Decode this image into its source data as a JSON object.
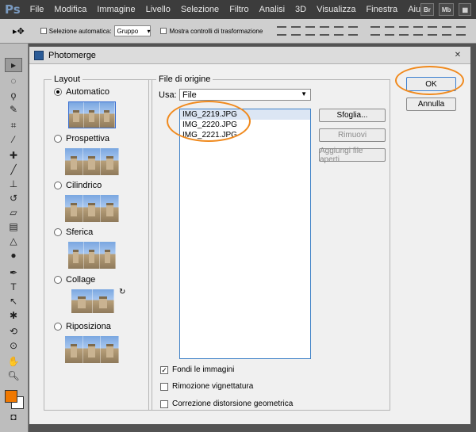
{
  "app": {
    "logo": "Ps",
    "menu": [
      "File",
      "Modifica",
      "Immagine",
      "Livello",
      "Selezione",
      "Filtro",
      "Analisi",
      "3D",
      "Visualizza",
      "Finestra",
      "Aiuto"
    ],
    "menu_right": [
      "Br",
      "Mb"
    ]
  },
  "options_bar": {
    "auto_select_label": "Selezione automatica:",
    "auto_select_value": "Gruppo",
    "show_transform_label": "Mostra controlli di trasformazione"
  },
  "dialog": {
    "title": "Photomerge",
    "layout": {
      "legend": "Layout",
      "options": [
        {
          "label": "Automatico",
          "selected": true
        },
        {
          "label": "Prospettiva",
          "selected": false
        },
        {
          "label": "Cilindrico",
          "selected": false
        },
        {
          "label": "Sferica",
          "selected": false
        },
        {
          "label": "Collage",
          "selected": false
        },
        {
          "label": "Riposiziona",
          "selected": false
        }
      ]
    },
    "source": {
      "legend": "File di origine",
      "use_label": "Usa:",
      "use_value": "File",
      "files": [
        "IMG_2219.JPG",
        "IMG_2220.JPG",
        "IMG_2221.JPG"
      ],
      "browse_button": "Sfoglia...",
      "remove_button": "Rimuovi",
      "add_open_button": "Aggiungi file aperti",
      "blend_label": "Fondi le immagini",
      "blend_checked": true,
      "vignette_label": "Rimozione vignettatura",
      "vignette_checked": false,
      "distortion_label": "Correzione distorsione geometrica",
      "distortion_checked": false
    },
    "ok_button": "OK",
    "cancel_button": "Annulla"
  },
  "colors": {
    "highlight_oval": "#f08a1e",
    "foreground_swatch": "#f07800"
  }
}
